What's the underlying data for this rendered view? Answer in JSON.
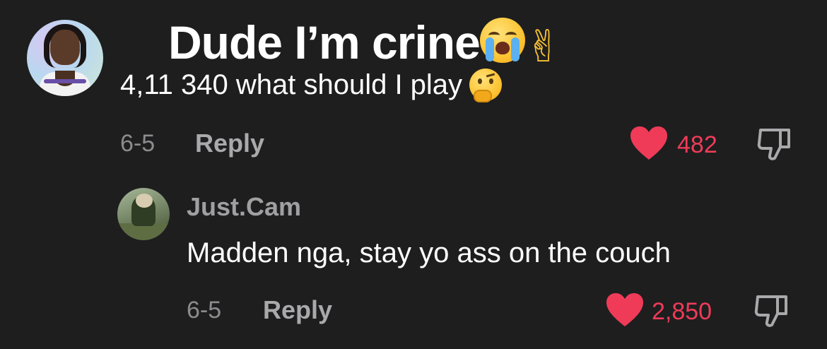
{
  "comment": {
    "title": "Dude I’m crine",
    "text": "4,11 340 what should I play",
    "emojis": [
      "loudly-crying-face",
      "victory-hand",
      "thinking-face"
    ],
    "date": "6-5",
    "reply_label": "Reply",
    "likes": "482"
  },
  "reply": {
    "username": "Just.Cam",
    "text": "Madden nga, stay yo ass on the couch",
    "date": "6-5",
    "reply_label": "Reply",
    "likes": "2,850"
  },
  "colors": {
    "background": "#1e1e1f",
    "like_red": "#ef3b58",
    "muted_text": "#8c8c8e"
  }
}
